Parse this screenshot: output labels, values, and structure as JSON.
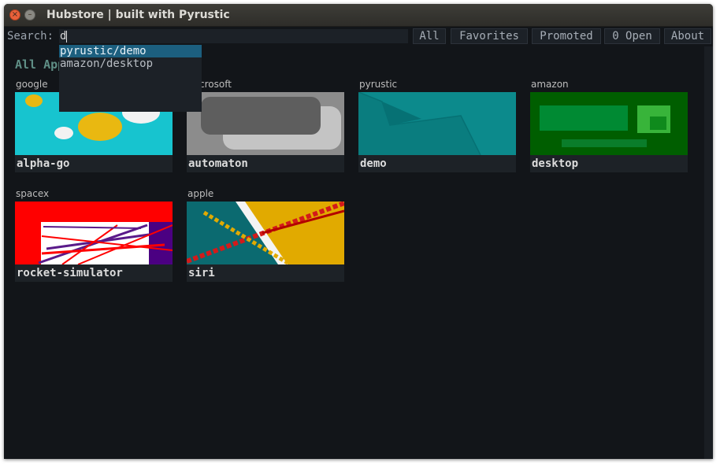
{
  "window": {
    "title": "Hubstore | built with Pyrustic",
    "close_glyph": "×",
    "minimize_glyph": "–"
  },
  "search": {
    "label": "Search:",
    "value": "d"
  },
  "nav": {
    "all": "All",
    "favorites": "Favorites",
    "promoted": "Promoted",
    "open": "0 Open",
    "about": "About"
  },
  "section_title": "All Apps",
  "apps": [
    {
      "owner": "google",
      "name": "alpha-go",
      "thumb_icon": "alpha-go-thumbnail"
    },
    {
      "owner": "microsoft",
      "name": "automaton",
      "thumb_icon": "automaton-thumbnail"
    },
    {
      "owner": "pyrustic",
      "name": "demo",
      "thumb_icon": "demo-thumbnail"
    },
    {
      "owner": "amazon",
      "name": "desktop",
      "thumb_icon": "desktop-thumbnail"
    },
    {
      "owner": "spacex",
      "name": "rocket-simulator",
      "thumb_icon": "rocket-simulator-thumbnail"
    },
    {
      "owner": "apple",
      "name": "siri",
      "thumb_icon": "siri-thumbnail"
    }
  ],
  "autocomplete": {
    "items": [
      "pyrustic/demo",
      "amazon/desktop"
    ],
    "selected_index": 0
  },
  "colors": {
    "background": "#121519",
    "accent": "#1c5f7f",
    "section_title": "#5f8f86"
  }
}
